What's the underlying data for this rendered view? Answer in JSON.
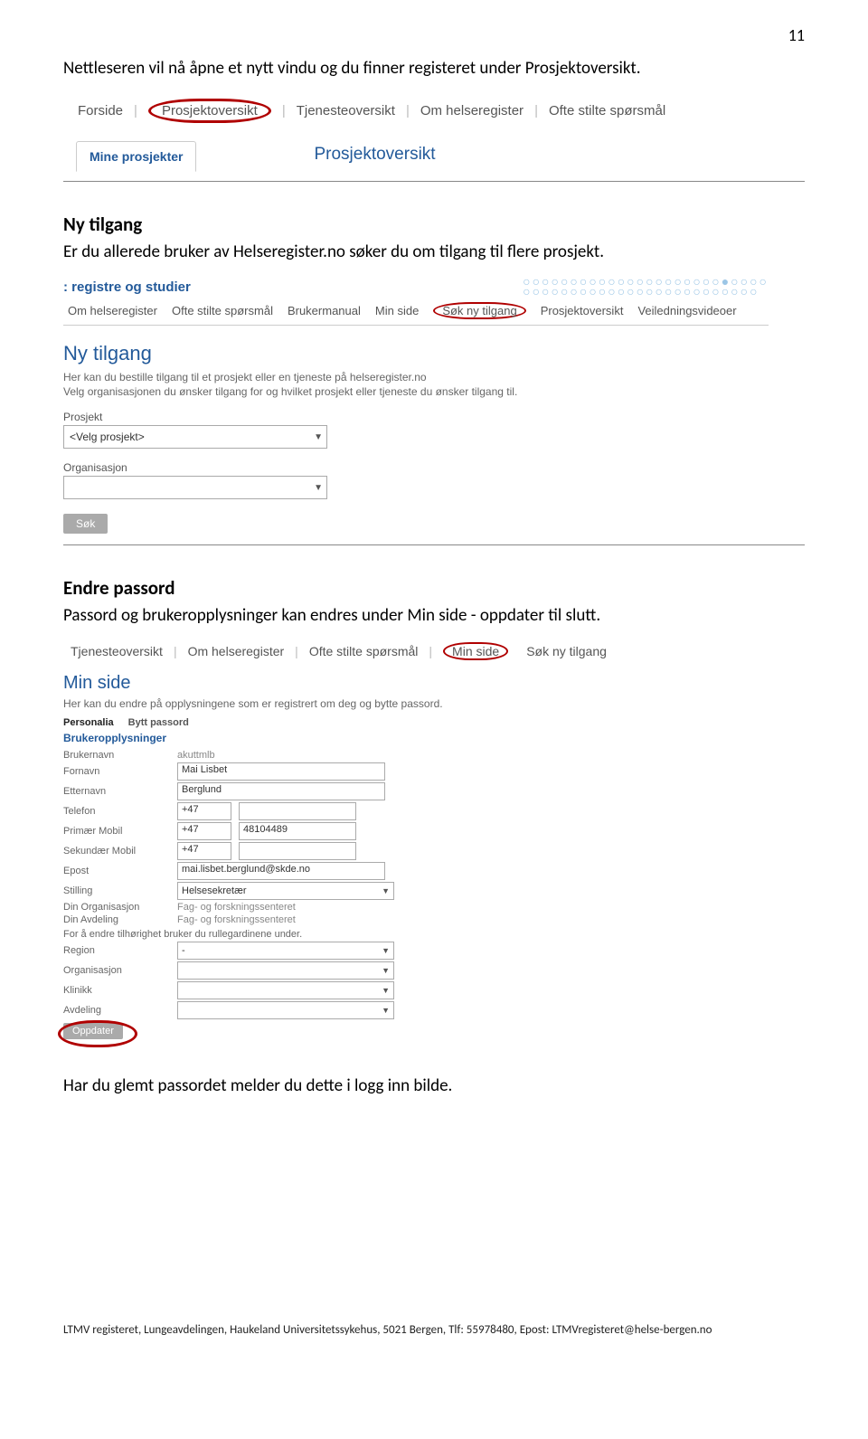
{
  "page_number": "11",
  "intro_text": "Nettleseren vil nå åpne et nytt vindu og du finner registeret under Prosjektoversikt.",
  "shot1": {
    "tabs": [
      "Forside",
      "Prosjektoversikt",
      "Tjenesteoversikt",
      "Om helseregister",
      "Ofte stilte spørsmål"
    ],
    "mine_prosjekter": "Mine prosjekter",
    "heading": "Prosjektoversikt"
  },
  "section_nytilgang": {
    "title": "Ny tilgang",
    "text": "Er du allerede bruker av Helseregister.no søker du om tilgang til flere prosjekt."
  },
  "shot2": {
    "topleft": ": registre og studier",
    "tabs": [
      "Om helseregister",
      "Ofte stilte spørsmål",
      "Brukermanual",
      "Min side",
      "Søk ny tilgang",
      "Prosjektoversikt",
      "Veiledningsvideoer"
    ],
    "heading": "Ny tilgang",
    "desc1": "Her kan du bestille tilgang til et prosjekt eller en tjeneste på helseregister.no",
    "desc2": "Velg organisasjonen du ønsker tilgang for og hvilket prosjekt eller tjeneste du ønsker tilgang til.",
    "label_prosjekt": "Prosjekt",
    "select_prosjekt": "<Velg prosjekt>",
    "label_org": "Organisasjon",
    "sok": "Søk"
  },
  "section_endre": {
    "title": "Endre passord",
    "text": "Passord og brukeropplysninger kan endres under Min side - oppdater til slutt."
  },
  "shot3": {
    "tabs": [
      "Tjenesteoversikt",
      "Om helseregister",
      "Ofte stilte spørsmål",
      "Min side",
      "Søk ny tilgang"
    ],
    "heading": "Min side",
    "desc": "Her kan du endre på opplysningene som er registrert om deg og bytte passord.",
    "tab_personalia": "Personalia",
    "tab_bytt": "Bytt passord",
    "brukeropp": "Brukeropplysninger",
    "rows": {
      "brukernavn_lbl": "Brukernavn",
      "brukernavn_val": "akuttmlb",
      "fornavn_lbl": "Fornavn",
      "fornavn_val": "Mai Lisbet",
      "etternavn_lbl": "Etternavn",
      "etternavn_val": "Berglund",
      "telefon_lbl": "Telefon",
      "telefon_prefix": "+47",
      "primmob_lbl": "Primær Mobil",
      "primmob_prefix": "+47",
      "primmob_val": "48104489",
      "sekmob_lbl": "Sekundær Mobil",
      "sekmob_prefix": "+47",
      "epost_lbl": "Epost",
      "epost_val": "mai.lisbet.berglund@skde.no",
      "stilling_lbl": "Stilling",
      "stilling_val": "Helsesekretær",
      "dinorg_lbl": "Din Organisasjon",
      "dinorg_val": "Fag- og forskningssenteret",
      "dinavd_lbl": "Din Avdeling",
      "dinavd_val": "Fag- og forskningssenteret",
      "note": "For å endre tilhørighet bruker du rullegardinene under.",
      "region_lbl": "Region",
      "region_val": "-",
      "org_lbl": "Organisasjon",
      "klinikk_lbl": "Klinikk",
      "avdeling_lbl": "Avdeling"
    },
    "oppdater": "Oppdater"
  },
  "closing_text": "Har du glemt passordet melder du dette i logg inn bilde.",
  "footer": "LTMV registeret, Lungeavdelingen, Haukeland Universitetssykehus, 5021 Bergen, Tlf: 55978480, Epost: LTMVregisteret@helse-bergen.no"
}
